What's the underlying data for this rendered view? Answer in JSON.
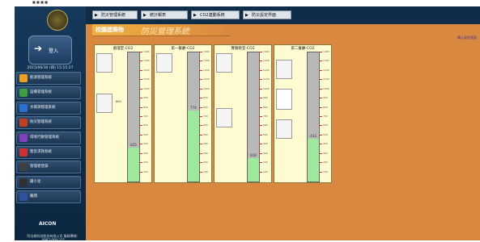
{
  "top": {
    "text": "■ ■ ■ ■"
  },
  "sidebar": {
    "login": "登入",
    "datetime": "2015/06/30 (四) 15:15:27",
    "items": [
      {
        "label": "能源管理系統",
        "icon": "sun-icon",
        "color": "#f0a020"
      },
      {
        "label": "設備管理系統",
        "icon": "gear-icon",
        "color": "#3aa040"
      },
      {
        "label": "水資源管理系統",
        "icon": "water-icon",
        "color": "#2a70d0"
      },
      {
        "label": "防災管理系統",
        "icon": "shield-icon",
        "color": "#c04020"
      },
      {
        "label": "環境行動管理系統",
        "icon": "building-icon",
        "color": "#8040c0"
      },
      {
        "label": "緊急求救系統",
        "icon": "alert-icon",
        "color": "#d03030"
      },
      {
        "label": "管理者登錄",
        "icon": "user-icon",
        "color": "#404040"
      },
      {
        "label": "最小化",
        "icon": "minimize-icon",
        "color": "#303030"
      },
      {
        "label": "離開",
        "icon": "exit-icon",
        "color": "#3050a0"
      }
    ],
    "brand": "AICON",
    "company": "阿法微科技股份有限公司 服務專線：0987-000-321"
  },
  "nav": {
    "tabs": [
      "防災管理系統",
      "統計報表",
      "CO2連動系統",
      "防災設定界面"
    ]
  },
  "main": {
    "banner_small": "校園建築物",
    "banner_large": "防災管理系統",
    "side_link": "購入設定頁面",
    "panels": [
      {
        "title": "處理室-CO2",
        "value_label": "825",
        "level": 0.26,
        "marker": "800"
      },
      {
        "title": "第一餐廳-CO2",
        "value_label": "774",
        "level": 0.55,
        "marker": "800"
      },
      {
        "title": "實驗教室-CO2",
        "value_label": "818",
        "level": 0.18,
        "marker": "800"
      },
      {
        "title": "第二餐廳-CO2",
        "value_label": "433",
        "level": 0.33,
        "marker": "800"
      }
    ],
    "tick_labels": [
      "1400",
      "1300",
      "1200",
      "1100",
      "1000",
      "900",
      "800",
      "700",
      "600",
      "500",
      "400",
      "300",
      "200",
      "100"
    ]
  }
}
